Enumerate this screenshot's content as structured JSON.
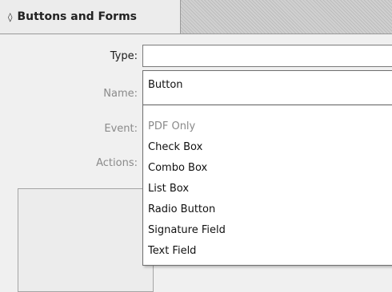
{
  "panel": {
    "title": "Buttons and Forms",
    "collapse_icon": "up-down-chevron-icon"
  },
  "fields": {
    "type_label": "Type:",
    "name_label": "Name:",
    "event_label": "Event:",
    "actions_label": "Actions:",
    "type_value": ""
  },
  "dropdown": {
    "selected": "Button",
    "header": "PDF Only",
    "items": [
      "Check Box",
      "Combo Box",
      "List Box",
      "Radio Button",
      "Signature Field",
      "Text Field"
    ]
  }
}
